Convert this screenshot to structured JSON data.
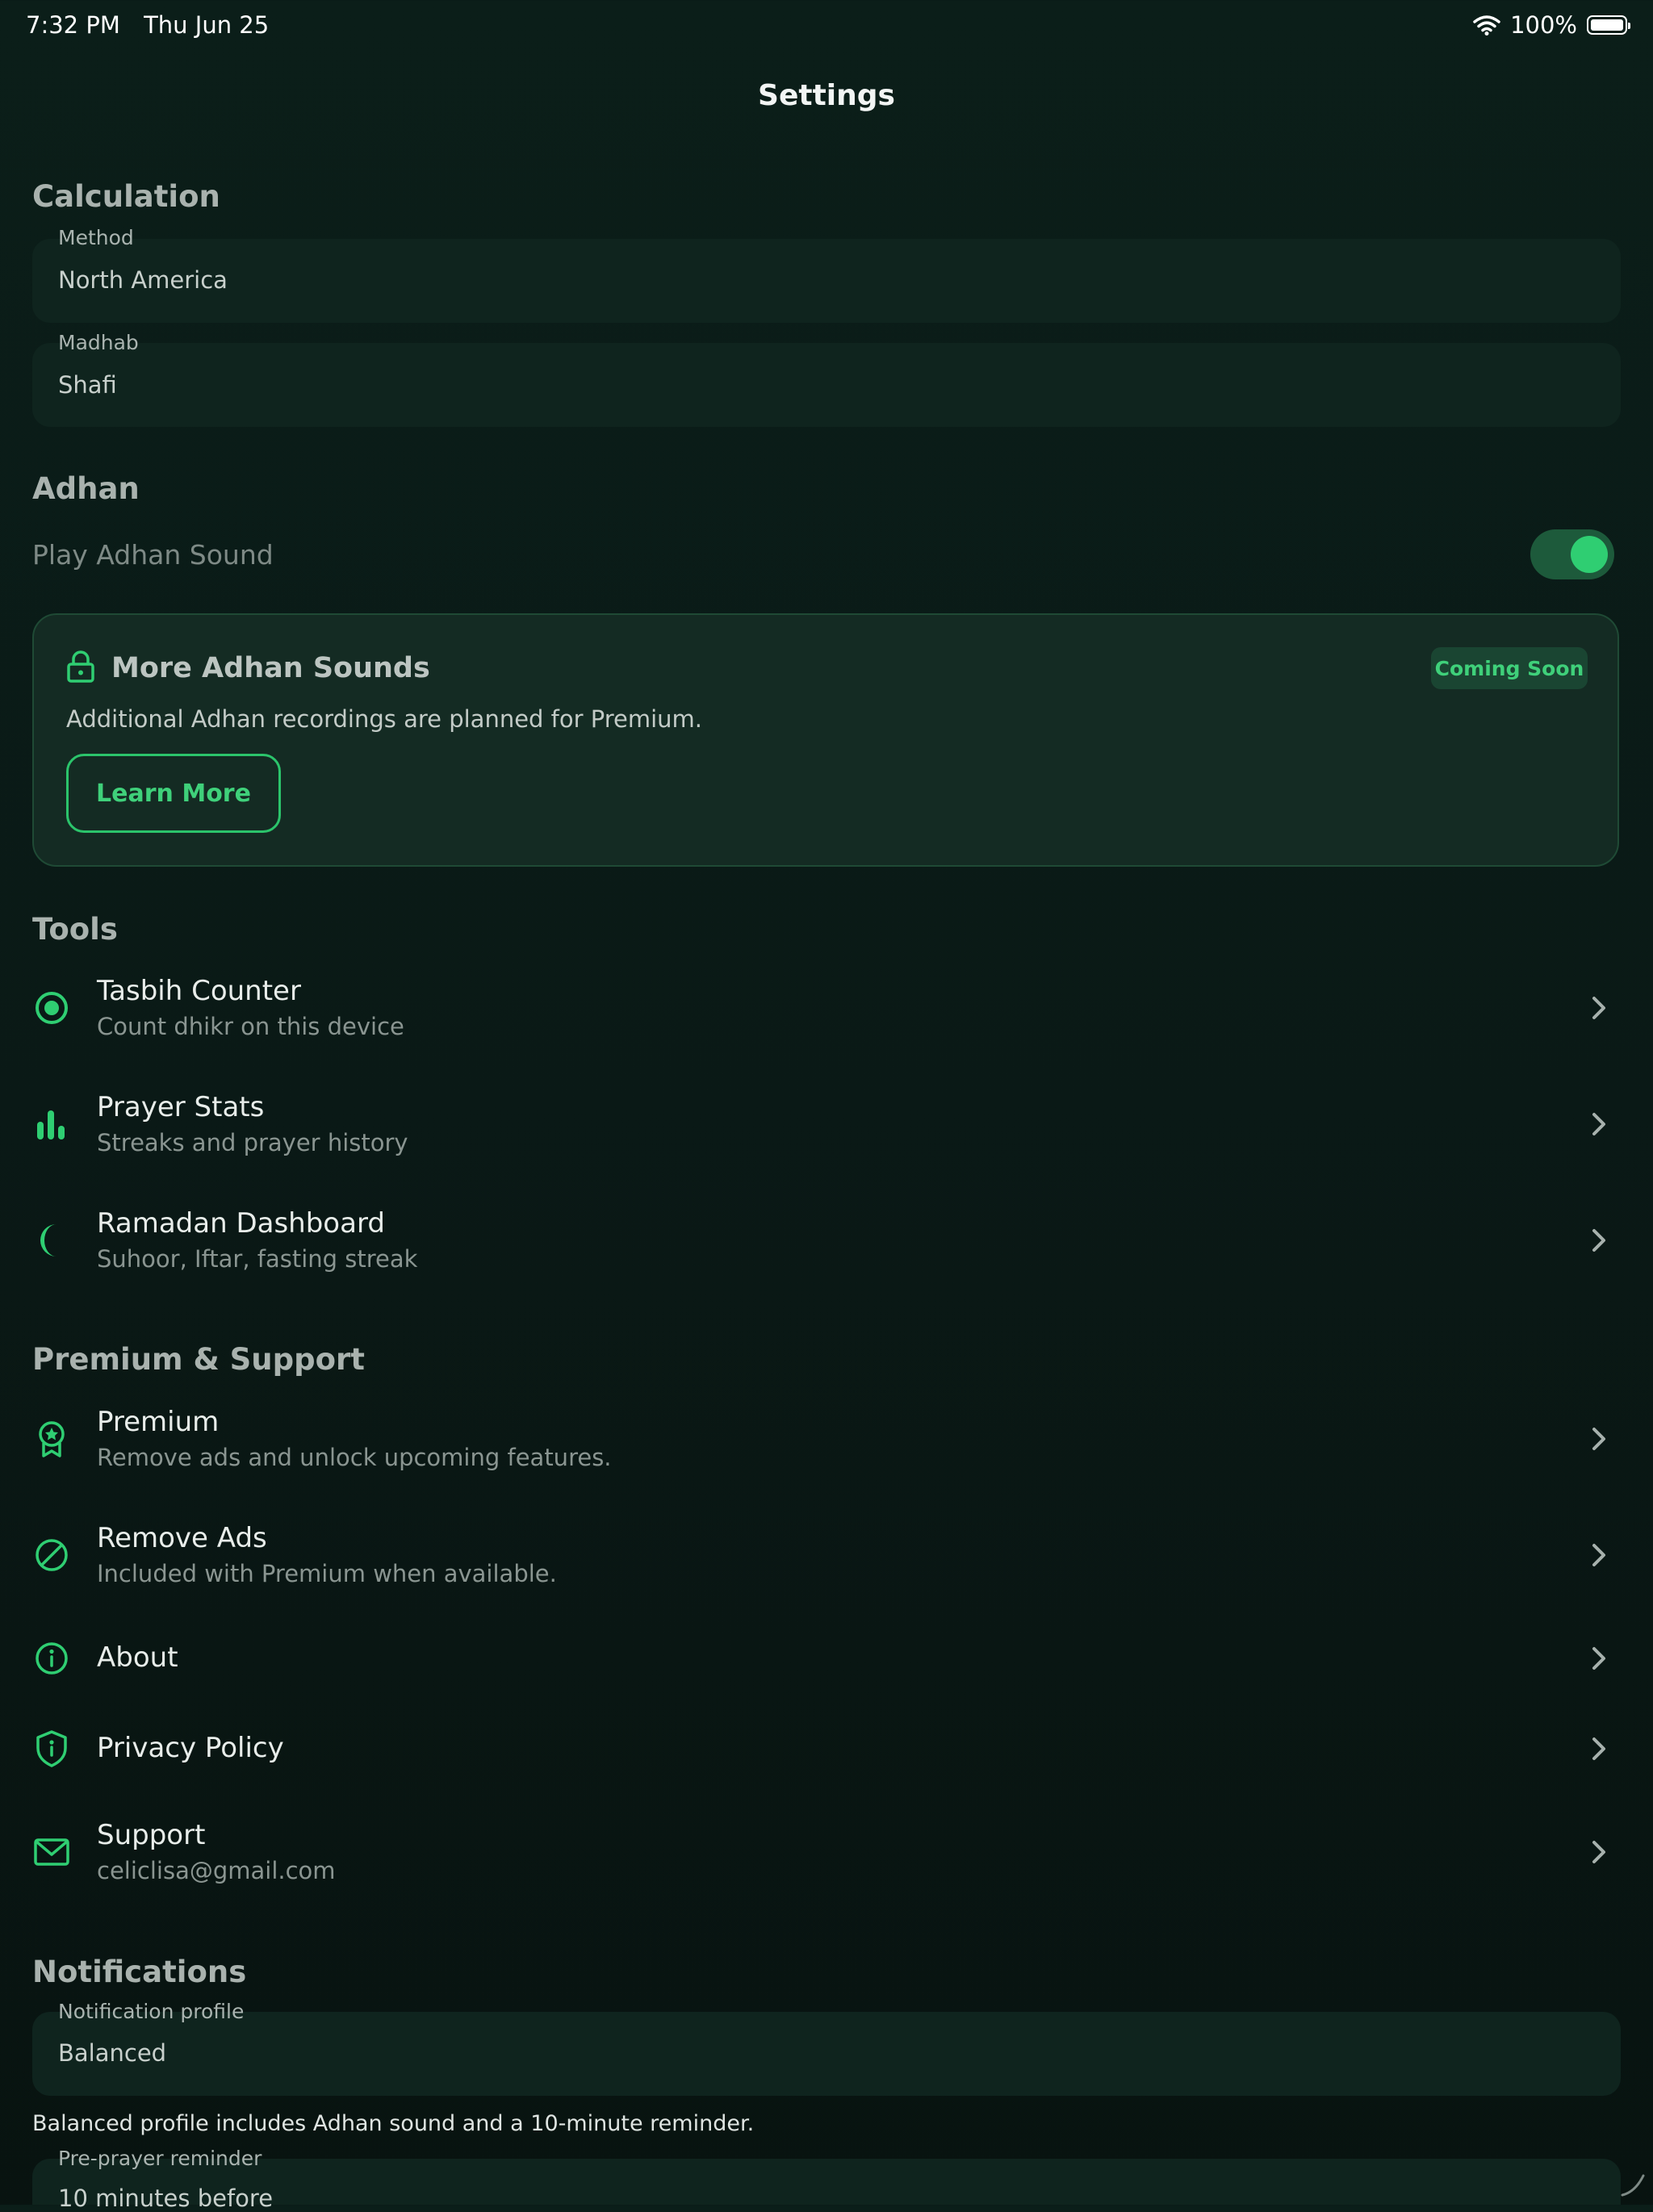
{
  "status_bar": {
    "time": "7:32 PM",
    "date": "Thu Jun 25",
    "battery": "100%"
  },
  "page_title": "Settings",
  "calculation": {
    "title": "Calculation",
    "method": {
      "label": "Method",
      "value": "North America"
    },
    "madhab": {
      "label": "Madhab",
      "value": "Shafi"
    }
  },
  "adhan": {
    "title": "Adhan",
    "play_sound": {
      "label": "Play Adhan Sound",
      "on": true
    },
    "card": {
      "title": "More Adhan Sounds",
      "badge": "Coming Soon",
      "description": "Additional Adhan recordings are planned for Premium.",
      "button": "Learn More"
    }
  },
  "tools": {
    "title": "Tools",
    "items": [
      {
        "title": "Tasbih Counter",
        "subtitle": "Count dhikr on this device",
        "icon": "target-icon"
      },
      {
        "title": "Prayer Stats",
        "subtitle": "Streaks and prayer history",
        "icon": "bar-chart-icon"
      },
      {
        "title": "Ramadan Dashboard",
        "subtitle": "Suhoor, Iftar, fasting streak",
        "icon": "crescent-moon-icon"
      }
    ]
  },
  "premium_support": {
    "title": "Premium & Support",
    "items": [
      {
        "title": "Premium",
        "subtitle": "Remove ads and unlock upcoming features.",
        "icon": "award-ribbon-icon"
      },
      {
        "title": "Remove Ads",
        "subtitle": "Included with Premium when available.",
        "icon": "block-icon"
      },
      {
        "title": "About",
        "icon": "info-icon"
      },
      {
        "title": "Privacy Policy",
        "icon": "shield-info-icon"
      },
      {
        "title": "Support",
        "subtitle": "celiclisa@gmail.com",
        "icon": "envelope-icon"
      }
    ]
  },
  "notifications": {
    "title": "Notifications",
    "profile": {
      "label": "Notification profile",
      "value": "Balanced"
    },
    "note": "Balanced profile includes Adhan sound and a 10-minute reminder.",
    "reminder": {
      "label": "Pre-prayer reminder",
      "value": "10 minutes before"
    }
  },
  "colors": {
    "accent": "#2fce72",
    "background": "#0b1e19",
    "card": "#142b23"
  }
}
